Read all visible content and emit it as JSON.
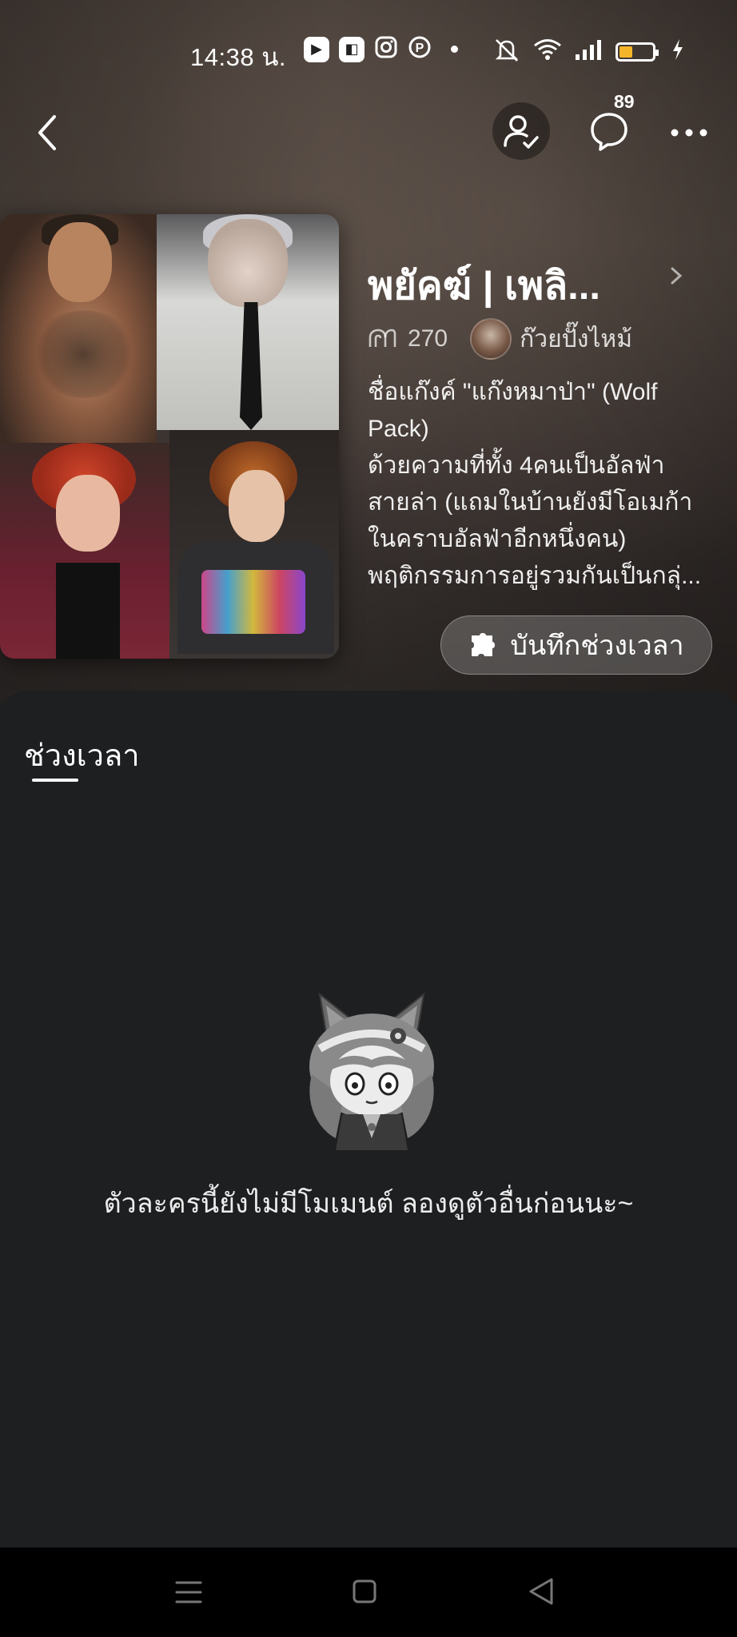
{
  "status_bar": {
    "time": "14:38 น.",
    "notification_icons": [
      "play-icon",
      "sticker-icon",
      "instagram-icon",
      "pinterest-icon"
    ],
    "right_icons": [
      "mute-icon",
      "wifi-icon",
      "signal-icon",
      "battery-icon",
      "charging-icon"
    ],
    "battery_color": "#f5b52a"
  },
  "nav": {
    "chat_count": "89"
  },
  "character": {
    "title": "พยัคฆ์ | เพลิ...",
    "views": "270",
    "author": "ก๊วยปั๊งไหม้",
    "description_lines": [
      "ชื่อแก๊งค์ \"แก๊งหมาป่า\" (Wolf",
      "Pack)",
      "ด้วยความที่ทั้ง 4คนเป็นอัลฟ่า",
      "สายล่า (แถมในบ้านยังมีโอเมก้า",
      "ในคราบอัลฟ่าอีกหนึ่งคน)",
      "พฤติกรรมการอยู่รวมกันเป็นกลุ่..."
    ],
    "save_button_label": "บันทึกช่วงเวลา"
  },
  "sheet": {
    "tab_label": "ช่วงเวลา",
    "empty_message": "ตัวละครนี้ยังไม่มีโมเมนต์ ลองดูตัวอื่นก่อนนะ~"
  },
  "system_nav": {
    "buttons": [
      "menu-icon",
      "home-icon",
      "back-icon"
    ]
  }
}
